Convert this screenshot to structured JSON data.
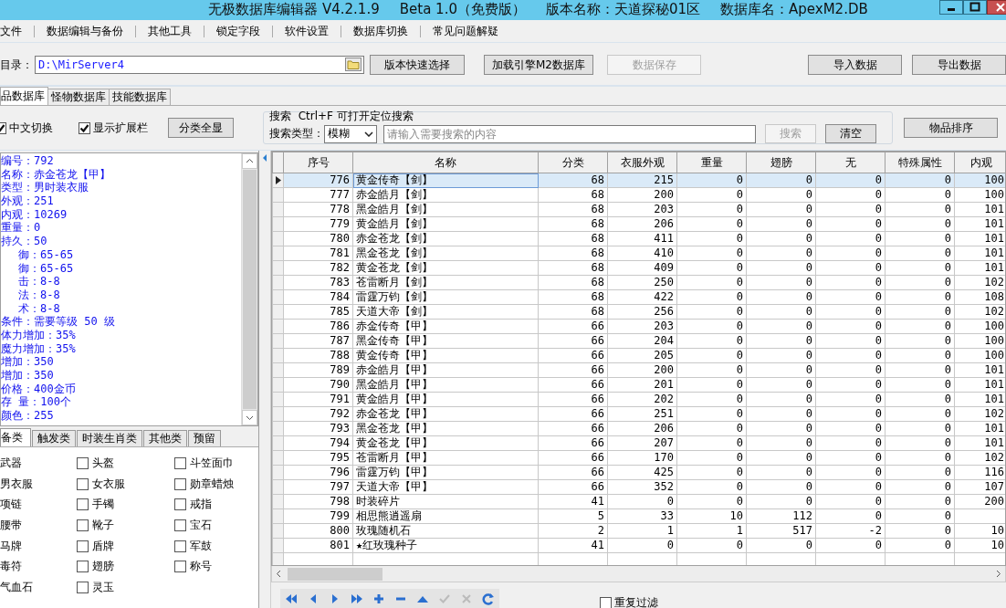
{
  "window": {
    "title_parts": [
      "无极数据库编辑器 V4.2.1.9",
      "Beta 1.0（免费版）",
      "版本名称：天道探秘01区",
      "数据库名：ApexM2.DB"
    ]
  },
  "menu": [
    "文件",
    "数据编辑与备份",
    "其他工具",
    "锁定字段",
    "软件设置",
    "数据库切换",
    "常见问题解疑"
  ],
  "toolbar": {
    "dir_label": "目录：",
    "dir_value": "D:\\MirServer4",
    "buttons": [
      {
        "label": "版本快速选择",
        "disabled": false
      },
      {
        "label": "加载引擎M2数据库",
        "disabled": false
      },
      {
        "label": "数据保存",
        "disabled": true
      }
    ],
    "right_buttons": [
      {
        "label": "导入数据",
        "disabled": false
      },
      {
        "label": "导出数据",
        "disabled": false
      }
    ]
  },
  "tabs": [
    {
      "label": "品数据库",
      "selected": true
    },
    {
      "label": "怪物数据库",
      "selected": false
    },
    {
      "label": "技能数据库",
      "selected": false
    }
  ],
  "options": {
    "checkboxes": [
      {
        "label": "中文切换",
        "checked": true
      },
      {
        "label": "显示扩展栏",
        "checked": true
      }
    ],
    "button": "分类全显"
  },
  "search": {
    "hint": "搜索  Ctrl+F 可打开定位搜索",
    "type_label": "搜索类型：",
    "type_value": "模糊",
    "placeholder": "请输入需要搜索的内容",
    "buttons": [
      {
        "label": "搜索",
        "disabled": true
      },
      {
        "label": "清空",
        "disabled": false
      }
    ]
  },
  "sort_button": "物品排序",
  "info_lines": [
    {
      "text": "编号：792",
      "indent": false
    },
    {
      "text": "名称：赤金苍龙【甲】",
      "indent": false
    },
    {
      "text": "类型：男时装衣服",
      "indent": false
    },
    {
      "text": "外观：251",
      "indent": false
    },
    {
      "text": "内观：10269",
      "indent": false
    },
    {
      "text": "重量：0",
      "indent": false
    },
    {
      "text": "持久：50",
      "indent": false
    },
    {
      "text": "御：65-65",
      "indent": true
    },
    {
      "text": "御：65-65",
      "indent": true
    },
    {
      "text": "击：8-8",
      "indent": true
    },
    {
      "text": "法：8-8",
      "indent": true
    },
    {
      "text": "术：8-8",
      "indent": true
    },
    {
      "text": "条件：需要等级 50 级",
      "indent": false
    },
    {
      "text": "体力增加：35%",
      "indent": false
    },
    {
      "text": "魔力增加：35%",
      "indent": false
    },
    {
      "text": "增加：350",
      "indent": false
    },
    {
      "text": "增加：350",
      "indent": false
    },
    {
      "text": "价格：400金币",
      "indent": false
    },
    {
      "text": "存 量：100个",
      "indent": false
    },
    {
      "text": "颜色：255",
      "indent": false
    }
  ],
  "category_tabs": [
    {
      "label": "备类",
      "selected": true
    },
    {
      "label": "触发类",
      "selected": false
    },
    {
      "label": "时装生肖类",
      "selected": false
    },
    {
      "label": "其他类",
      "selected": false
    },
    {
      "label": "预留",
      "selected": false
    }
  ],
  "categories": [
    {
      "label": "武器",
      "kind": "cut"
    },
    {
      "label": "头盔",
      "kind": "checkbox",
      "checked": false
    },
    {
      "label": "斗笠面巾",
      "kind": "checkbox",
      "checked": false
    },
    {
      "label": "男衣服",
      "kind": "cut"
    },
    {
      "label": "女衣服",
      "kind": "checkbox",
      "checked": false
    },
    {
      "label": "勋章蜡烛",
      "kind": "checkbox",
      "checked": false
    },
    {
      "label": "项链",
      "kind": "cut"
    },
    {
      "label": "手镯",
      "kind": "checkbox",
      "checked": false
    },
    {
      "label": "戒指",
      "kind": "checkbox",
      "checked": false
    },
    {
      "label": "腰带",
      "kind": "cut"
    },
    {
      "label": "靴子",
      "kind": "checkbox",
      "checked": false
    },
    {
      "label": "宝石",
      "kind": "checkbox",
      "checked": false
    },
    {
      "label": "马牌",
      "kind": "cut"
    },
    {
      "label": "盾牌",
      "kind": "checkbox",
      "checked": false
    },
    {
      "label": "军鼓",
      "kind": "checkbox",
      "checked": false
    },
    {
      "label": "毒符",
      "kind": "cut"
    },
    {
      "label": "翅膀",
      "kind": "checkbox",
      "checked": false
    },
    {
      "label": "称号",
      "kind": "checkbox",
      "checked": false
    },
    {
      "label": "气血石",
      "kind": "cut"
    },
    {
      "label": "灵玉",
      "kind": "checkbox",
      "checked": false
    }
  ],
  "table": {
    "columns": [
      "序号",
      "名称",
      "分类",
      "衣服外观",
      "重量",
      "翅膀",
      "无",
      "特殊属性",
      "内观"
    ],
    "rows": [
      {
        "selected": true,
        "cells": [
          "776",
          "黄金传奇【剑】",
          "68",
          "215",
          "0",
          "0",
          "0",
          "0",
          "100"
        ]
      },
      {
        "selected": false,
        "cells": [
          "777",
          "赤金皓月【剑】",
          "68",
          "200",
          "0",
          "0",
          "0",
          "0",
          "100"
        ]
      },
      {
        "selected": false,
        "cells": [
          "778",
          "黑金皓月【剑】",
          "68",
          "203",
          "0",
          "0",
          "0",
          "0",
          "101"
        ]
      },
      {
        "selected": false,
        "cells": [
          "779",
          "黄金皓月【剑】",
          "68",
          "206",
          "0",
          "0",
          "0",
          "0",
          "101"
        ]
      },
      {
        "selected": false,
        "cells": [
          "780",
          "赤金苍龙【剑】",
          "68",
          "411",
          "0",
          "0",
          "0",
          "0",
          "101"
        ]
      },
      {
        "selected": false,
        "cells": [
          "781",
          "黑金苍龙【剑】",
          "68",
          "410",
          "0",
          "0",
          "0",
          "0",
          "101"
        ]
      },
      {
        "selected": false,
        "cells": [
          "782",
          "黄金苍龙【剑】",
          "68",
          "409",
          "0",
          "0",
          "0",
          "0",
          "101"
        ]
      },
      {
        "selected": false,
        "cells": [
          "783",
          "苍雷断月【剑】",
          "68",
          "250",
          "0",
          "0",
          "0",
          "0",
          "102"
        ]
      },
      {
        "selected": false,
        "cells": [
          "784",
          "雷霆万钧【剑】",
          "68",
          "422",
          "0",
          "0",
          "0",
          "0",
          "108"
        ]
      },
      {
        "selected": false,
        "cells": [
          "785",
          "天道大帝【剑】",
          "68",
          "256",
          "0",
          "0",
          "0",
          "0",
          "102"
        ]
      },
      {
        "selected": false,
        "cells": [
          "786",
          "赤金传奇【甲】",
          "66",
          "203",
          "0",
          "0",
          "0",
          "0",
          "100"
        ]
      },
      {
        "selected": false,
        "cells": [
          "787",
          "黑金传奇【甲】",
          "66",
          "204",
          "0",
          "0",
          "0",
          "0",
          "100"
        ]
      },
      {
        "selected": false,
        "cells": [
          "788",
          "黄金传奇【甲】",
          "66",
          "205",
          "0",
          "0",
          "0",
          "0",
          "100"
        ]
      },
      {
        "selected": false,
        "cells": [
          "789",
          "赤金皓月【甲】",
          "66",
          "200",
          "0",
          "0",
          "0",
          "0",
          "101"
        ]
      },
      {
        "selected": false,
        "cells": [
          "790",
          "黑金皓月【甲】",
          "66",
          "201",
          "0",
          "0",
          "0",
          "0",
          "101"
        ]
      },
      {
        "selected": false,
        "cells": [
          "791",
          "黄金皓月【甲】",
          "66",
          "202",
          "0",
          "0",
          "0",
          "0",
          "101"
        ]
      },
      {
        "selected": false,
        "cells": [
          "792",
          "赤金苍龙【甲】",
          "66",
          "251",
          "0",
          "0",
          "0",
          "0",
          "102"
        ]
      },
      {
        "selected": false,
        "cells": [
          "793",
          "黑金苍龙【甲】",
          "66",
          "206",
          "0",
          "0",
          "0",
          "0",
          "101"
        ]
      },
      {
        "selected": false,
        "cells": [
          "794",
          "黄金苍龙【甲】",
          "66",
          "207",
          "0",
          "0",
          "0",
          "0",
          "101"
        ]
      },
      {
        "selected": false,
        "cells": [
          "795",
          "苍雷断月【甲】",
          "66",
          "170",
          "0",
          "0",
          "0",
          "0",
          "102"
        ]
      },
      {
        "selected": false,
        "cells": [
          "796",
          "雷霆万钧【甲】",
          "66",
          "425",
          "0",
          "0",
          "0",
          "0",
          "116"
        ]
      },
      {
        "selected": false,
        "cells": [
          "797",
          "天道大帝【甲】",
          "66",
          "352",
          "0",
          "0",
          "0",
          "0",
          "107"
        ]
      },
      {
        "selected": false,
        "cells": [
          "798",
          "时装碎片",
          "41",
          "0",
          "0",
          "0",
          "0",
          "0",
          "200"
        ]
      },
      {
        "selected": false,
        "cells": [
          "799",
          "相思熊逍遥扇",
          "5",
          "33",
          "10",
          "112",
          "0",
          "0"
        ]
      },
      {
        "selected": false,
        "cells": [
          "800",
          "玫瑰随机石",
          "2",
          "1",
          "1",
          "517",
          "-2",
          "0",
          "10"
        ]
      },
      {
        "selected": false,
        "cells": [
          "801",
          "★红玫瑰种子",
          "41",
          "0",
          "0",
          "0",
          "0",
          "0",
          "10"
        ]
      }
    ]
  },
  "navigator": {
    "filter": {
      "label": "重复过滤",
      "checked": false
    }
  }
}
